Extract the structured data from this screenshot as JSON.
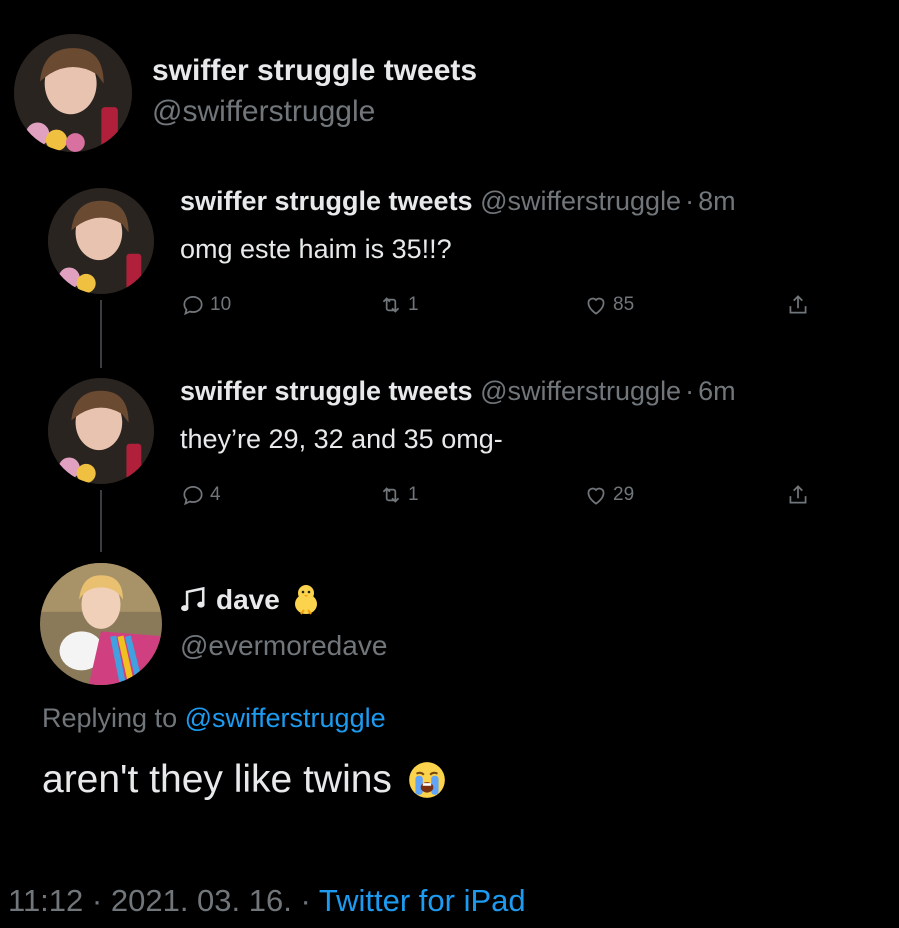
{
  "main_user": {
    "display_name": "swiffer struggle tweets",
    "handle": "@swifferstruggle"
  },
  "tweets": [
    {
      "display_name": "swiffer struggle tweets",
      "handle": "@swifferstruggle",
      "separator": "·",
      "time": "8m",
      "text": "omg este haim is 35!!?",
      "replies": "10",
      "retweets": "1",
      "likes": "85"
    },
    {
      "display_name": "swiffer struggle tweets",
      "handle": "@swifferstruggle",
      "separator": "·",
      "time": "6m",
      "text": "they’re 29, 32 and 35 omg-",
      "replies": "4",
      "retweets": "1",
      "likes": "29"
    }
  ],
  "reply": {
    "display_name": "dave",
    "name_prefix_icon": "music-note-icon",
    "name_suffix_icon": "chick-emoji-icon",
    "handle": "@evermoredave",
    "replying_label": "Replying to",
    "replying_handle": "@swifferstruggle",
    "text": "aren't they like twins",
    "text_emoji_icon": "crying-face-emoji-icon"
  },
  "footer": {
    "time": "11:12",
    "sep1": "·",
    "date": "2021. 03. 16.",
    "sep2": "·",
    "source": "Twitter for iPad"
  },
  "colors": {
    "background": "#000000",
    "text": "#e7e9ea",
    "muted": "#71767b",
    "link": "#1d9bf0"
  }
}
